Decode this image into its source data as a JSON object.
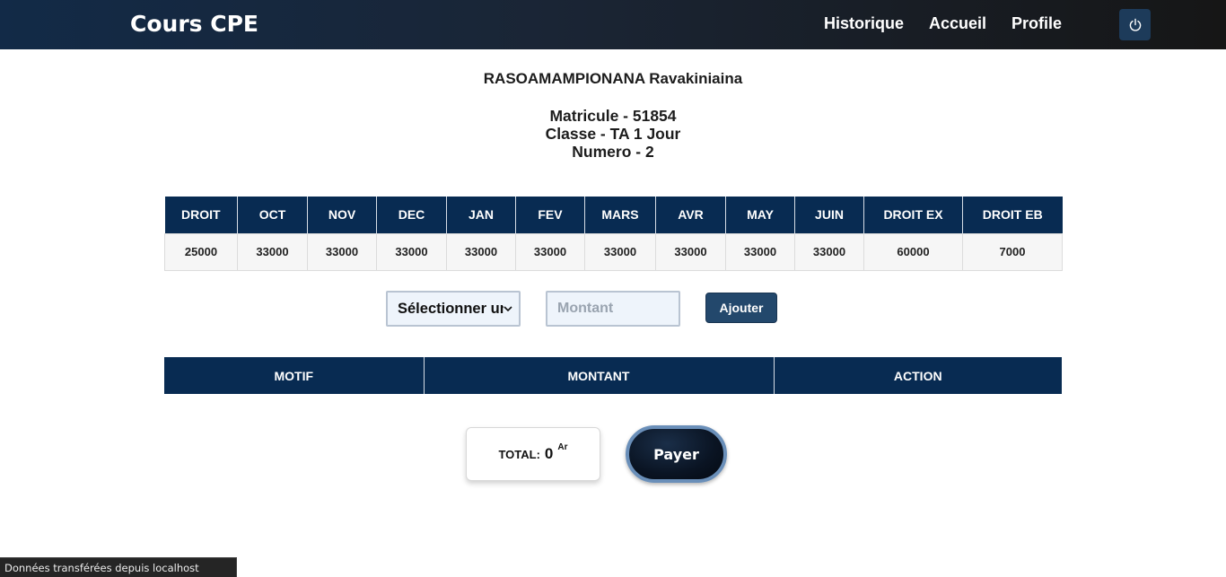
{
  "navbar": {
    "brand": "Cours CPE",
    "links": [
      {
        "label": "Historique"
      },
      {
        "label": "Accueil"
      },
      {
        "label": "Profile"
      }
    ],
    "logout_icon": "power-icon"
  },
  "student": {
    "name": "RASOAMAMPIONANA Ravakiniaina",
    "matricule": "Matricule - 51854",
    "classe": "Classe - TA 1 Jour",
    "numero": "Numero - 2"
  },
  "fees_table": {
    "headers": [
      "DROIT",
      "OCT",
      "NOV",
      "DEC",
      "JAN",
      "FEV",
      "MARS",
      "AVR",
      "MAY",
      "JUIN",
      "DROIT EX",
      "DROIT EB"
    ],
    "values": [
      "25000",
      "33000",
      "33000",
      "33000",
      "33000",
      "33000",
      "33000",
      "33000",
      "33000",
      "33000",
      "60000",
      "7000"
    ]
  },
  "form": {
    "select_value": "Sélectionner un",
    "amount_placeholder": "Montant",
    "amount_value": "",
    "add_label": "Ajouter"
  },
  "items_table": {
    "headers": [
      "MOTIF",
      "MONTANT",
      "ACTION"
    ],
    "rows": []
  },
  "total": {
    "label": "TOTAL:",
    "value": "0",
    "unit": "Ar"
  },
  "pay_label": "Payer",
  "status_bar": "Données transférées depuis localhost",
  "colors": {
    "nav_start": "#122a47",
    "nav_end": "#161616",
    "table_header": "#082b52",
    "button_primary": "#23486c"
  }
}
